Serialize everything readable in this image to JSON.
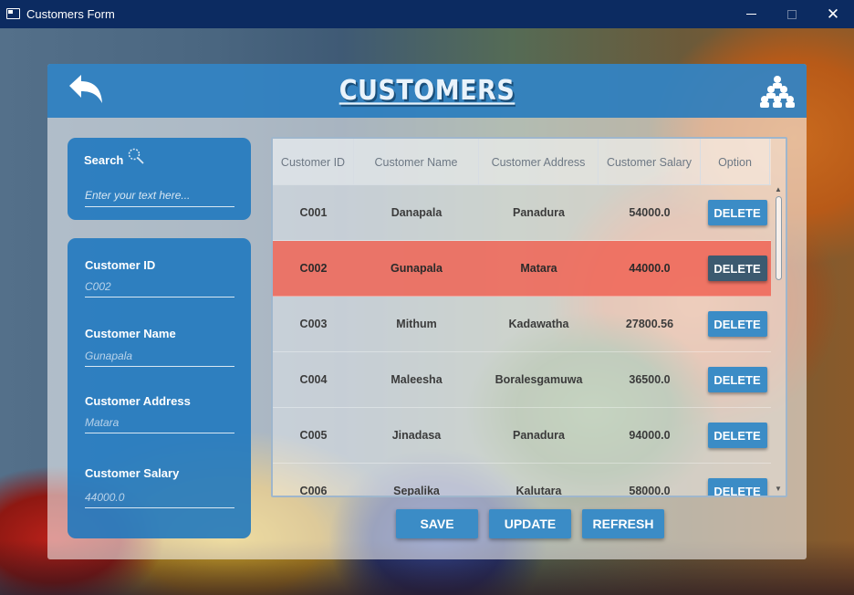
{
  "window": {
    "title": "Customers Form",
    "close_glyph": "✕"
  },
  "header": {
    "title": "CUSTOMERS",
    "back_icon": "back-arrow-icon",
    "people_icon": "people-group-icon"
  },
  "colors": {
    "header": "#1e78be",
    "card": "#1c76be",
    "button": "#3b8cc6",
    "selected_row": "#f06455",
    "titlebar": "#0c2b61"
  },
  "search": {
    "label": "Search",
    "placeholder": "Enter your text here..."
  },
  "form": {
    "fields": [
      {
        "label": "Customer ID",
        "value": "C002"
      },
      {
        "label": "Customer Name",
        "value": "Gunapala"
      },
      {
        "label": "Customer Address",
        "value": "Matara"
      },
      {
        "label": "Customer Salary",
        "value": "44000.0"
      }
    ]
  },
  "table": {
    "columns": [
      "Customer ID",
      "Customer Name",
      "Customer Address",
      "Customer Salary",
      "Option"
    ],
    "delete_label": "DELETE",
    "selected_row": 1,
    "rows": [
      {
        "id": "C001",
        "name": "Danapala",
        "address": "Panadura",
        "salary": "54000.0"
      },
      {
        "id": "C002",
        "name": "Gunapala",
        "address": "Matara",
        "salary": "44000.0"
      },
      {
        "id": "C003",
        "name": "Mithum",
        "address": "Kadawatha",
        "salary": "27800.56"
      },
      {
        "id": "C004",
        "name": "Maleesha",
        "address": "Boralesgamuwa",
        "salary": "36500.0"
      },
      {
        "id": "C005",
        "name": "Jinadasa",
        "address": "Panadura",
        "salary": "94000.0"
      },
      {
        "id": "C006",
        "name": "Sepalika",
        "address": "Kalutara",
        "salary": "58000.0"
      }
    ]
  },
  "actions": {
    "save": "SAVE",
    "update": "UPDATE",
    "refresh": "REFRESH"
  }
}
